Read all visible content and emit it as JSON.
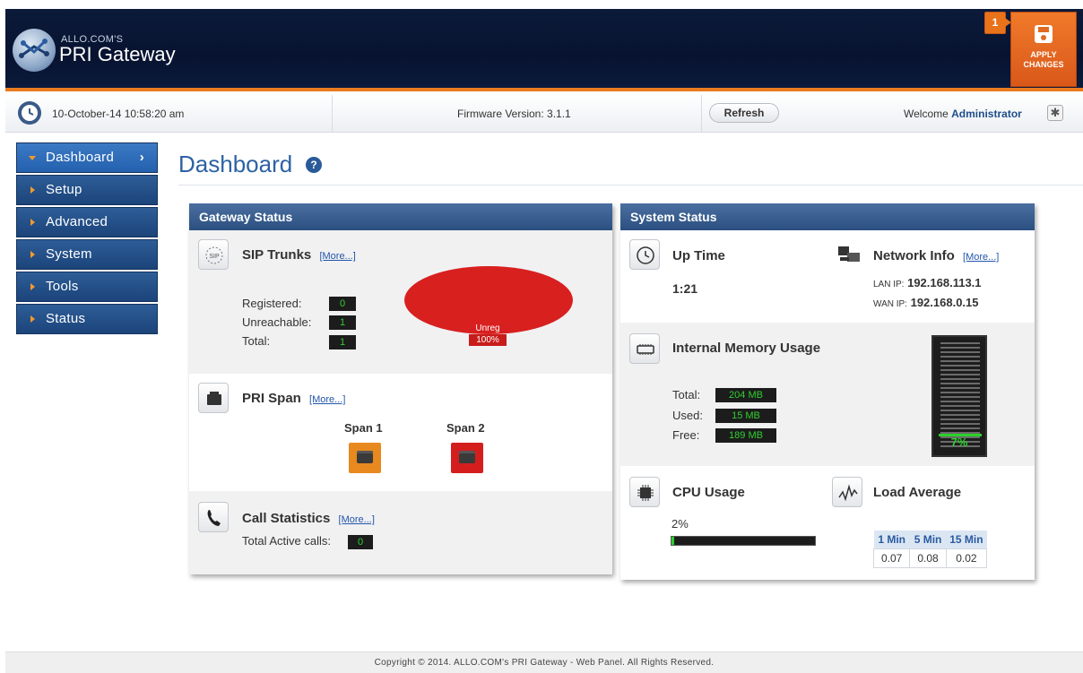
{
  "header": {
    "company": "ALLO.COM'S",
    "product": "PRI Gateway",
    "apply": {
      "badge": "1",
      "line1": "APPLY",
      "line2": "CHANGES"
    }
  },
  "infobar": {
    "datetime": "10-October-14  10:58:20 am",
    "firmware": "Firmware Version: 3.1.1",
    "refresh": "Refresh",
    "welcome_prefix": "Welcome",
    "user": "Administrator"
  },
  "sidebar": {
    "items": [
      {
        "label": "Dashboard",
        "active": true
      },
      {
        "label": "Setup"
      },
      {
        "label": "Advanced"
      },
      {
        "label": "System"
      },
      {
        "label": "Tools"
      },
      {
        "label": "Status"
      }
    ]
  },
  "page": {
    "title": "Dashboard"
  },
  "gateway": {
    "title": "Gateway Status",
    "sip": {
      "title": "SIP Trunks",
      "more": "[More...]",
      "registered_label": "Registered:",
      "registered": "0",
      "unreachable_label": "Unreachable:",
      "unreachable": "1",
      "total_label": "Total:",
      "total": "1",
      "pie_label": "Unreg",
      "pie_pct": "100%"
    },
    "pri": {
      "title": "PRI Span",
      "more": "[More...]",
      "span1": "Span 1",
      "span2": "Span 2",
      "span1_color": "#e8891f",
      "span2_color": "#d41e1e"
    },
    "calls": {
      "title": "Call Statistics",
      "more": "[More...]",
      "active_label": "Total Active calls:",
      "active": "0"
    }
  },
  "system": {
    "title": "System Status",
    "uptime": {
      "title": "Up Time",
      "value": "1:21"
    },
    "network": {
      "title": "Network Info",
      "more": "[More...]",
      "lan_label": "LAN IP:",
      "lan": "192.168.113.1",
      "wan_label": "WAN IP:",
      "wan": "192.168.0.15"
    },
    "memory": {
      "title": "Internal Memory Usage",
      "total_label": "Total:",
      "total": "204 MB",
      "used_label": "Used:",
      "used": "15 MB",
      "free_label": "Free:",
      "free": "189 MB",
      "pct": "7%",
      "used_fraction": 0.07
    },
    "cpu": {
      "title": "CPU Usage",
      "value": "2%",
      "fraction": 0.02
    },
    "load": {
      "title": "Load Average",
      "headers": [
        "1 Min",
        "5 Min",
        "15 Min"
      ],
      "values": [
        "0.07",
        "0.08",
        "0.02"
      ]
    }
  },
  "footer": "Copyright © 2014. ALLO.COM's PRI Gateway - Web Panel. All Rights Reserved."
}
